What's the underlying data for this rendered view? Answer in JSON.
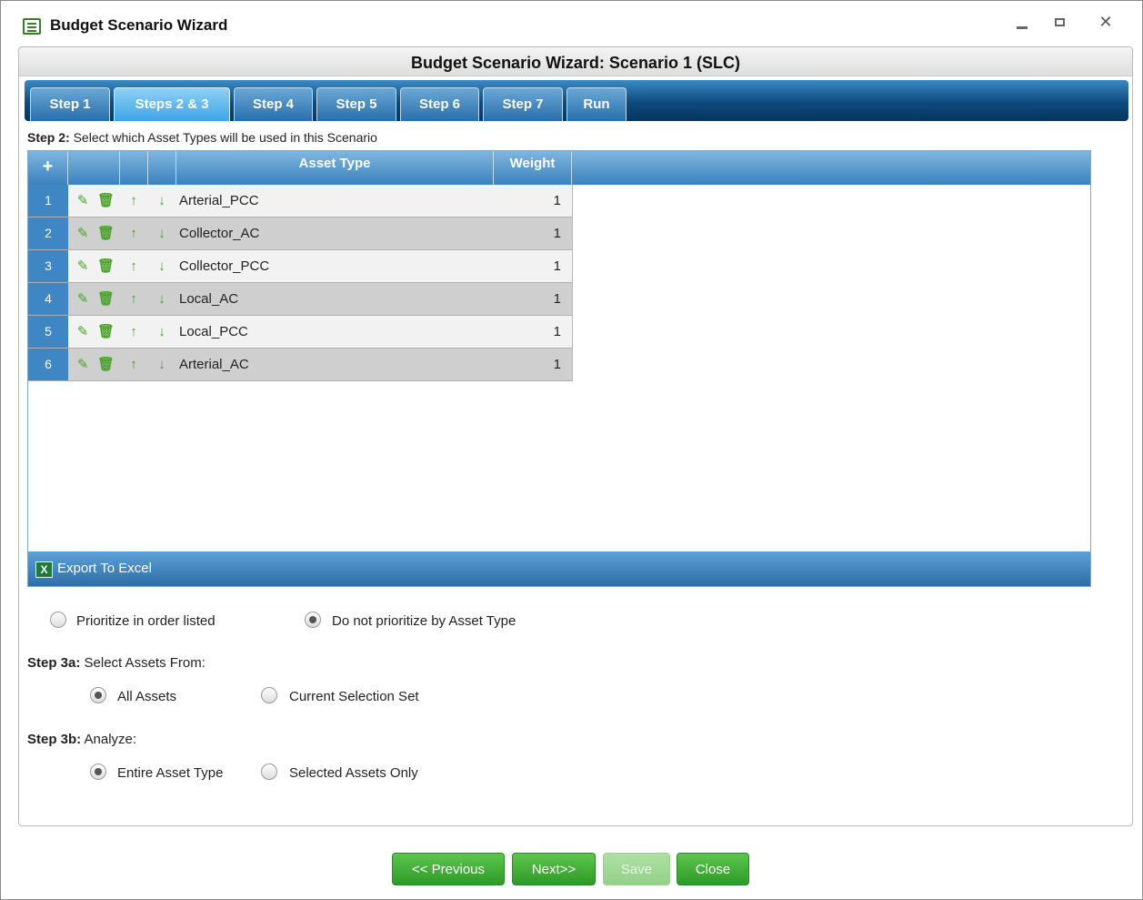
{
  "window": {
    "title": "Budget Scenario Wizard",
    "minimize_label": "",
    "maximize_label": "",
    "close_glyph": "✕"
  },
  "panel": {
    "header": "Budget Scenario Wizard: Scenario 1 (SLC)"
  },
  "tabs": [
    {
      "label": "Step 1",
      "active": false
    },
    {
      "label": "Steps 2 & 3",
      "active": true
    },
    {
      "label": "Step 4",
      "active": false
    },
    {
      "label": "Step 5",
      "active": false
    },
    {
      "label": "Step 6",
      "active": false
    },
    {
      "label": "Step 7",
      "active": false
    },
    {
      "label": "Run",
      "active": false
    }
  ],
  "step2": {
    "prefix": "Step 2:",
    "text": "Select which Asset Types will be used in this Scenario"
  },
  "grid": {
    "add_glyph": "+",
    "columns": {
      "asset_type": "Asset Type",
      "weight": "Weight"
    },
    "rows": [
      {
        "num": "1",
        "name": "Arterial_PCC",
        "weight": "1"
      },
      {
        "num": "2",
        "name": "Collector_AC",
        "weight": "1"
      },
      {
        "num": "3",
        "name": "Collector_PCC",
        "weight": "1"
      },
      {
        "num": "4",
        "name": "Local_AC",
        "weight": "1"
      },
      {
        "num": "5",
        "name": "Local_PCC",
        "weight": "1"
      },
      {
        "num": "6",
        "name": "Arterial_AC",
        "weight": "1"
      }
    ],
    "row_icons": {
      "edit": "✎",
      "delete": "🗑",
      "up": "↑",
      "down": "↓"
    },
    "export_label": "Export To Excel",
    "export_icon": "X"
  },
  "priority": {
    "option1": "Prioritize in order listed",
    "option2": "Do not prioritize by Asset Type",
    "selected": "option2"
  },
  "step3a": {
    "prefix": "Step 3a:",
    "text": "Select Assets From:",
    "option1": "All Assets",
    "option2": "Current Selection Set",
    "selected": "option1"
  },
  "step3b": {
    "prefix": "Step 3b:",
    "text": "Analyze:",
    "option1": "Entire Asset Type",
    "option2": "Selected Assets Only",
    "selected": "option1"
  },
  "buttons": {
    "previous": "<< Previous",
    "next": "Next>>",
    "save": "Save",
    "close": "Close"
  },
  "colors": {
    "tab_bar": "#0e4a7e",
    "active_tab": "#3ea4e6",
    "grid_header": "#3b82bd",
    "row_number": "#3e87c4",
    "icon_green": "#4aa32a",
    "button_green": "#2f9a2a"
  }
}
